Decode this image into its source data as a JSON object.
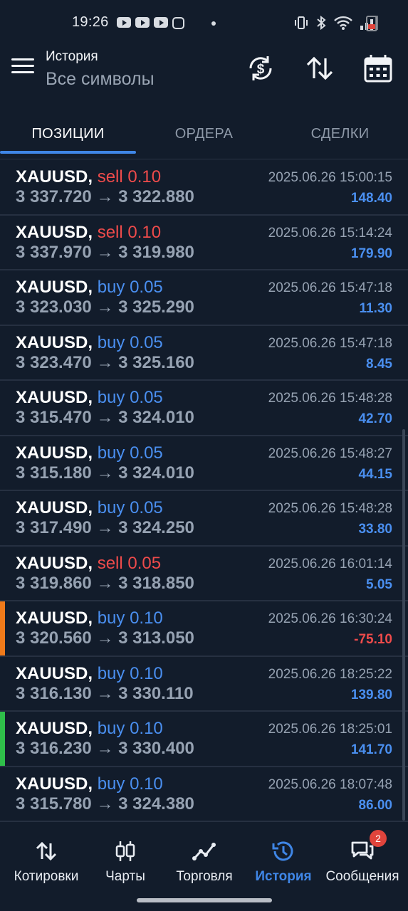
{
  "status_bar": {
    "time": "19:26"
  },
  "header": {
    "title": "История",
    "subtitle": "Все символы"
  },
  "tabs": [
    {
      "label": "ПОЗИЦИИ",
      "active": true
    },
    {
      "label": "ОРДЕРА",
      "active": false
    },
    {
      "label": "СДЕЛКИ",
      "active": false
    }
  ],
  "colors": {
    "accent": "#3f86e6",
    "sell": "#ef4b4b",
    "buy": "#4a8ff0",
    "marker_orange": "#f07a1a",
    "marker_green": "#2fbf4a"
  },
  "positions": [
    {
      "symbol": "XAUUSD,",
      "side": "sell",
      "volume": "0.10",
      "open": "3 337.720",
      "close": "3 322.880",
      "time": "2025.06.26 15:00:15",
      "profit": "148.40"
    },
    {
      "symbol": "XAUUSD,",
      "side": "sell",
      "volume": "0.10",
      "open": "3 337.970",
      "close": "3 319.980",
      "time": "2025.06.26 15:14:24",
      "profit": "179.90"
    },
    {
      "symbol": "XAUUSD,",
      "side": "buy",
      "volume": "0.05",
      "open": "3 323.030",
      "close": "3 325.290",
      "time": "2025.06.26 15:47:18",
      "profit": "11.30"
    },
    {
      "symbol": "XAUUSD,",
      "side": "buy",
      "volume": "0.05",
      "open": "3 323.470",
      "close": "3 325.160",
      "time": "2025.06.26 15:47:18",
      "profit": "8.45"
    },
    {
      "symbol": "XAUUSD,",
      "side": "buy",
      "volume": "0.05",
      "open": "3 315.470",
      "close": "3 324.010",
      "time": "2025.06.26 15:48:28",
      "profit": "42.70"
    },
    {
      "symbol": "XAUUSD,",
      "side": "buy",
      "volume": "0.05",
      "open": "3 315.180",
      "close": "3 324.010",
      "time": "2025.06.26 15:48:27",
      "profit": "44.15"
    },
    {
      "symbol": "XAUUSD,",
      "side": "buy",
      "volume": "0.05",
      "open": "3 317.490",
      "close": "3 324.250",
      "time": "2025.06.26 15:48:28",
      "profit": "33.80"
    },
    {
      "symbol": "XAUUSD,",
      "side": "sell",
      "volume": "0.05",
      "open": "3 319.860",
      "close": "3 318.850",
      "time": "2025.06.26 16:01:14",
      "profit": "5.05"
    },
    {
      "symbol": "XAUUSD,",
      "side": "buy",
      "volume": "0.10",
      "open": "3 320.560",
      "close": "3 313.050",
      "time": "2025.06.26 16:30:24",
      "profit": "-75.10",
      "marker": "orange"
    },
    {
      "symbol": "XAUUSD,",
      "side": "buy",
      "volume": "0.10",
      "open": "3 316.130",
      "close": "3 330.110",
      "time": "2025.06.26 18:25:22",
      "profit": "139.80"
    },
    {
      "symbol": "XAUUSD,",
      "side": "buy",
      "volume": "0.10",
      "open": "3 316.230",
      "close": "3 330.400",
      "time": "2025.06.26 18:25:01",
      "profit": "141.70",
      "marker": "green"
    },
    {
      "symbol": "XAUUSD,",
      "side": "buy",
      "volume": "0.10",
      "open": "3 315.780",
      "close": "3 324.380",
      "time": "2025.06.26 18:07:48",
      "profit": "86.00"
    }
  ],
  "arrow": "→",
  "bottom_nav": [
    {
      "label": "Котировки",
      "icon": "quotes-arrows-icon",
      "active": false
    },
    {
      "label": "Чарты",
      "icon": "candlestick-chart-icon",
      "active": false
    },
    {
      "label": "Торговля",
      "icon": "trade-line-icon",
      "active": false
    },
    {
      "label": "История",
      "icon": "history-clock-icon",
      "active": true
    },
    {
      "label": "Сообщения",
      "icon": "messages-icon",
      "active": false
    }
  ],
  "messages_badge": "2"
}
